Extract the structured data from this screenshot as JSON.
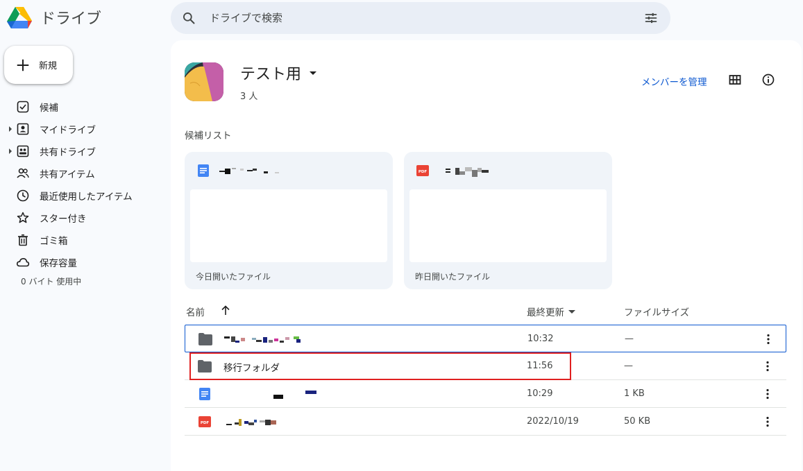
{
  "app": {
    "title": "ドライブ"
  },
  "search": {
    "placeholder": "ドライブで検索"
  },
  "new_button": {
    "label": "新規"
  },
  "sidebar": {
    "items": [
      {
        "label": "候補",
        "icon": "suggested-icon",
        "expandable": false
      },
      {
        "label": "マイドライブ",
        "icon": "my-drive-icon",
        "expandable": true
      },
      {
        "label": "共有ドライブ",
        "icon": "shared-drives-icon",
        "expandable": true
      },
      {
        "label": "共有アイテム",
        "icon": "shared-with-me-icon",
        "expandable": false
      },
      {
        "label": "最近使用したアイテム",
        "icon": "recent-icon",
        "expandable": false
      },
      {
        "label": "スター付き",
        "icon": "star-icon",
        "expandable": false
      },
      {
        "label": "ゴミ箱",
        "icon": "trash-icon",
        "expandable": false
      },
      {
        "label": "保存容量",
        "icon": "cloud-icon",
        "expandable": false
      }
    ],
    "storage_text": "0 バイト 使用中"
  },
  "shared_drive": {
    "name": "テスト用",
    "members": "3 人",
    "manage_members": "メンバーを管理"
  },
  "suggestions": {
    "title": "候補リスト",
    "cards": [
      {
        "type": "doc",
        "reason": "今日開いたファイル"
      },
      {
        "type": "pdf",
        "reason": "昨日開いたファイル"
      }
    ]
  },
  "list": {
    "headers": {
      "name": "名前",
      "modified": "最終更新",
      "size": "ファイルサイズ"
    },
    "rows": [
      {
        "type": "folder",
        "name": "",
        "modified": "10:32",
        "size": "—",
        "selected": true
      },
      {
        "type": "folder",
        "name": "移行フォルダ",
        "modified": "11:56",
        "size": "—",
        "highlighted": true
      },
      {
        "type": "doc",
        "name": "",
        "modified": "10:29",
        "size": "1 KB"
      },
      {
        "type": "pdf",
        "name": "",
        "modified": "2022/10/19",
        "size": "50 KB"
      }
    ]
  },
  "colors": {
    "accent": "#0b57d0",
    "highlight": "#e02020",
    "doc": "#4285f4",
    "pdf": "#ea4335",
    "folder": "#5f6368"
  }
}
